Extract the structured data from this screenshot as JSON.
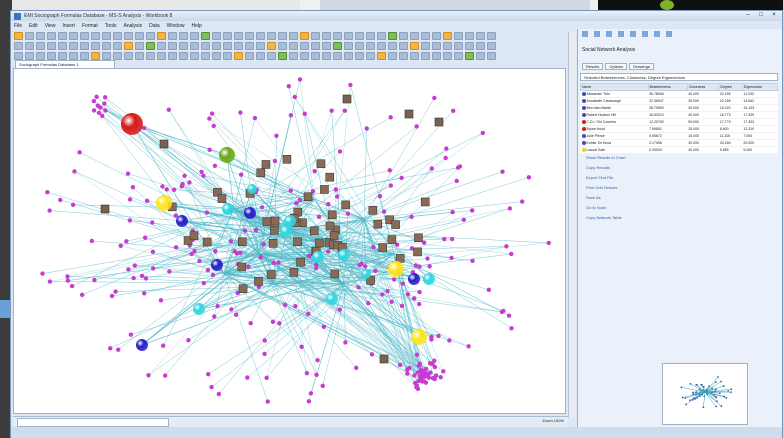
{
  "window": {
    "title": "EMI Sociograph Formulas Database - MS-S Analysis - Workbook 8",
    "controls": [
      "–",
      "□",
      "×"
    ]
  },
  "menu": [
    "File",
    "Edit",
    "View",
    "Insert",
    "Format",
    "Tools",
    "Analysis",
    "Data",
    "Window",
    "Help"
  ],
  "document_tab": "Sociograph Formulas Database 1",
  "status": {
    "text": "Zoom 100%"
  },
  "panel": {
    "title": "Social Network Analysis",
    "tabs": [
      "Results",
      "Options",
      "Drawings"
    ],
    "dataset": "Selected Betweenness, Closeness, Degree Eigenvectors",
    "columns": [
      "Name",
      "Betweenness",
      "Closeness",
      "Degree",
      "Eigenvector"
    ],
    "rows": [
      {
        "name": "Alexander Tuts",
        "v1": "35.78906",
        "v2": "40.000",
        "v3": "22.155",
        "v4": "11.033",
        "color": "#3a4fb8"
      },
      {
        "name": "Annabelle Cavanaugh",
        "v1": "22.36547",
        "v2": "35.000",
        "v3": "22.155",
        "v4": "14.662",
        "color": "#3a4fb8"
      },
      {
        "name": "Ben Alan Martin",
        "v1": "28.79893",
        "v2": "30.000",
        "v3": "15.220",
        "v4": "15.103",
        "color": "#3a4fb8"
      },
      {
        "name": "Robert Hudson Hill",
        "v1": "16.53213",
        "v2": "40.000",
        "v3": "16.773",
        "v4": "17.309",
        "color": "#3a4fb8"
      },
      {
        "name": "C.D.I. Old Couriers",
        "v1": "12.20763",
        "v2": "50.000",
        "v3": "17.779",
        "v4": "17.303",
        "color": "#c81e1e"
      },
      {
        "name": "Bryan Hood",
        "v1": "7.56892",
        "v2": "25.000",
        "v3": "8.600",
        "v4": "12.310",
        "color": "#c81e1e"
      },
      {
        "name": "Julie Pieroe",
        "v1": "5.55672",
        "v2": "15.000",
        "v3": "11.100",
        "v4": "7.000",
        "color": "#3a4fb8"
      },
      {
        "name": "Kohler Sir Hood",
        "v1": "2.17056",
        "v2": "30.000",
        "v3": "20.160",
        "v4": "20.000",
        "color": "#3a4fb8"
      },
      {
        "name": "Lasual Gale",
        "v1": "0.09034",
        "v2": "40.000",
        "v3": "5.655",
        "v4": "5.000",
        "color": "#e8d01a"
      },
      {
        "name": "Kate Webine",
        "v1": "0.01200",
        "v2": "40.000",
        "v3": "10.470",
        "v4": "3.800",
        "color": "#e8d01a"
      },
      {
        "name": "Kix Webine",
        "v1": "0.00000",
        "v2": "15.000",
        "v3": "10.470",
        "v4": "5.600",
        "color": "#e8d01a"
      }
    ],
    "actions": [
      "Show Results in Chart",
      "Copy Results",
      "Export Text File",
      "Print Grid Results",
      "Save As",
      "Go to Node",
      "Copy Network Table"
    ]
  },
  "colors": {
    "node_magenta": "#c83bd0",
    "node_cyan": "#2fd6e0",
    "node_blue": "#2420c8",
    "node_yellow": "#ffe31a",
    "node_red": "#d81818",
    "node_green": "#6aa81a",
    "edge": "#4fb8c8"
  }
}
